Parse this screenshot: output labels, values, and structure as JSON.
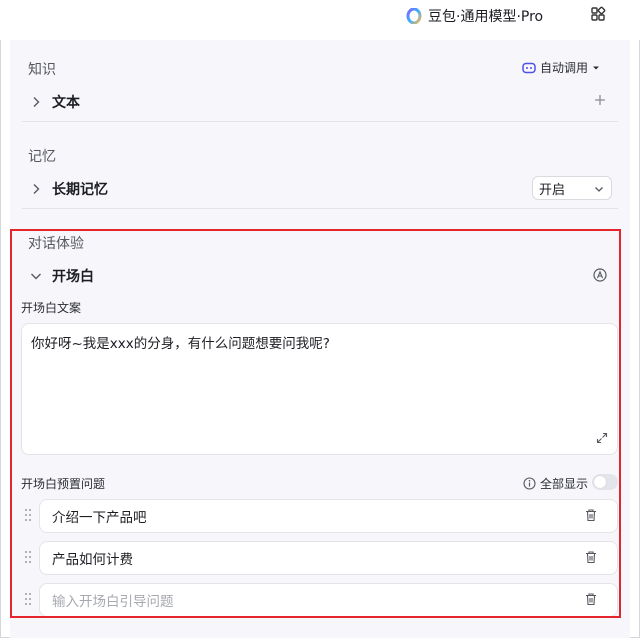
{
  "header": {
    "model_name": "豆包·通用模型·Pro"
  },
  "knowledge": {
    "section_title": "知识",
    "auto_call_label": "自动调用",
    "text_row_label": "文本"
  },
  "memory": {
    "section_title": "记忆",
    "long_term_label": "长期记忆",
    "select_value": "开启"
  },
  "dialog": {
    "section_title": "对话体验",
    "opening_label": "开场白",
    "opening_text_label": "开场白文案",
    "opening_text_value": "你好呀~我是xxx的分身，有什么问题想要问我呢?",
    "preset_questions_label": "开场白预置问题",
    "show_all_label": "全部显示",
    "show_all_enabled": false,
    "questions": [
      {
        "value": "介绍一下产品吧"
      },
      {
        "value": "产品如何计费"
      }
    ],
    "new_question_placeholder": "输入开场白引导问题"
  },
  "colors": {
    "highlight_border": "#e4262c",
    "panel_bg": "#f7f7fb",
    "auto_call_icon": "#4e52e6"
  },
  "icons": [
    "doubao-logo-icon",
    "grid-icon",
    "chevron-right-icon",
    "chevron-down-icon",
    "plus-icon",
    "robot-icon",
    "caret-down-icon",
    "a-circle-icon",
    "expand-icon",
    "info-icon",
    "drag-handle-icon",
    "trash-icon"
  ]
}
